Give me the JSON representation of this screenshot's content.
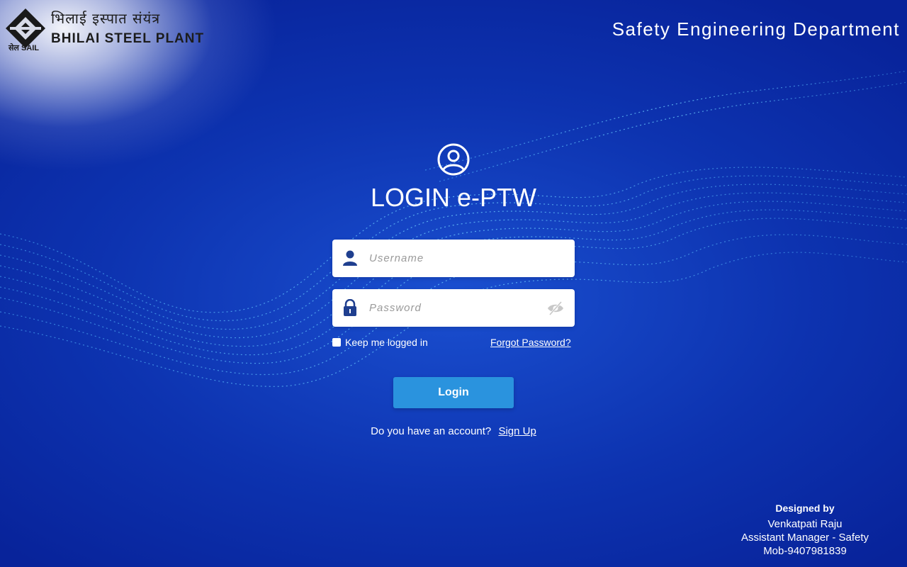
{
  "branding": {
    "hindi_name": "भिलाई इस्पात संयंत्र",
    "english_name": "BHILAI STEEL PLANT",
    "sail_label": "सेल SAIL"
  },
  "header": {
    "department": "Safety Engineering Department"
  },
  "login": {
    "title": "LOGIN e-PTW",
    "username_placeholder": "Username",
    "username_value": "",
    "password_placeholder": "Password",
    "password_value": "",
    "keep_logged_in_label": "Keep me logged in",
    "keep_logged_in_checked": false,
    "forgot_password": "Forgot Password?",
    "submit_label": "Login",
    "account_question": "Do you have an account?",
    "signup_link": "Sign Up"
  },
  "credits": {
    "heading": "Designed by",
    "name": "Venkatpati Raju",
    "designation": "Assistant Manager - Safety",
    "mobile": "Mob-9407981839"
  },
  "colors": {
    "background": "#0c2fa8",
    "button": "#2a93de",
    "field_icon": "#1f3f8f"
  },
  "icons": {
    "logo": "sail-logo-icon",
    "profile": "user-circle-icon",
    "username": "user-icon",
    "password": "lock-icon",
    "toggle": "eye-slash-icon"
  }
}
